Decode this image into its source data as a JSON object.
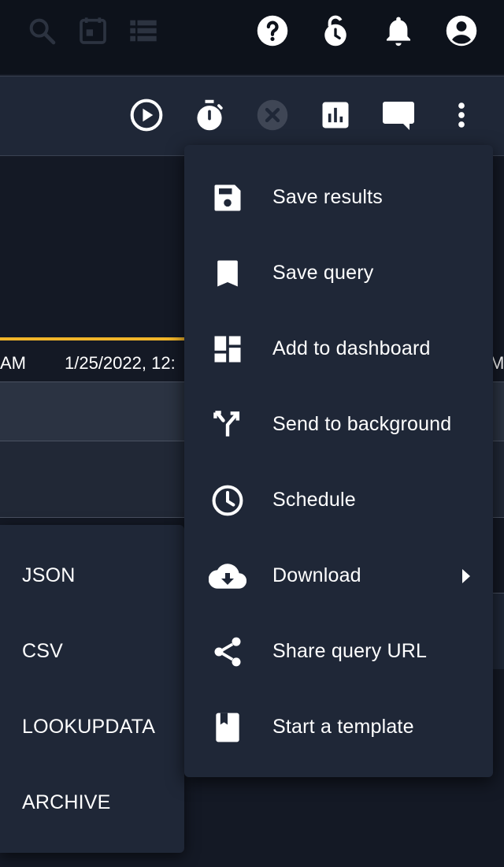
{
  "timeline": {
    "left_label": "AM",
    "timestamp": "1/25/2022, 12:",
    "right_label": "M"
  },
  "top_icons": [
    "search-icon",
    "calendar-icon",
    "list-icon",
    "help-icon",
    "timer-lock-icon",
    "notifications-icon",
    "account-icon"
  ],
  "toolbar_icons": [
    "run-icon",
    "stopwatch-icon",
    "cancel-icon",
    "chart-icon",
    "comment-icon",
    "more-vert-icon"
  ],
  "menu": {
    "items": [
      {
        "label": "Save results",
        "icon": "save-icon"
      },
      {
        "label": "Save query",
        "icon": "bookmark-icon"
      },
      {
        "label": "Add to dashboard",
        "icon": "dashboard-icon"
      },
      {
        "label": "Send to background",
        "icon": "fork-icon"
      },
      {
        "label": "Schedule",
        "icon": "clock-icon"
      },
      {
        "label": "Download",
        "icon": "cloud-download-icon",
        "submenu": true
      },
      {
        "label": "Share query URL",
        "icon": "share-icon"
      },
      {
        "label": "Start a template",
        "icon": "template-icon"
      }
    ]
  },
  "download_submenu": {
    "items": [
      {
        "label": "JSON"
      },
      {
        "label": "CSV"
      },
      {
        "label": "LOOKUPDATA"
      },
      {
        "label": "ARCHIVE"
      }
    ]
  },
  "colors": {
    "topbar_bg": "#0d121b",
    "panel_bg": "#1f2737",
    "page_bg": "#141925",
    "accent": "#f1b52a",
    "text": "#ffffff",
    "icon_disabled": "#3f4655",
    "icon_muted": "#2c3340"
  }
}
